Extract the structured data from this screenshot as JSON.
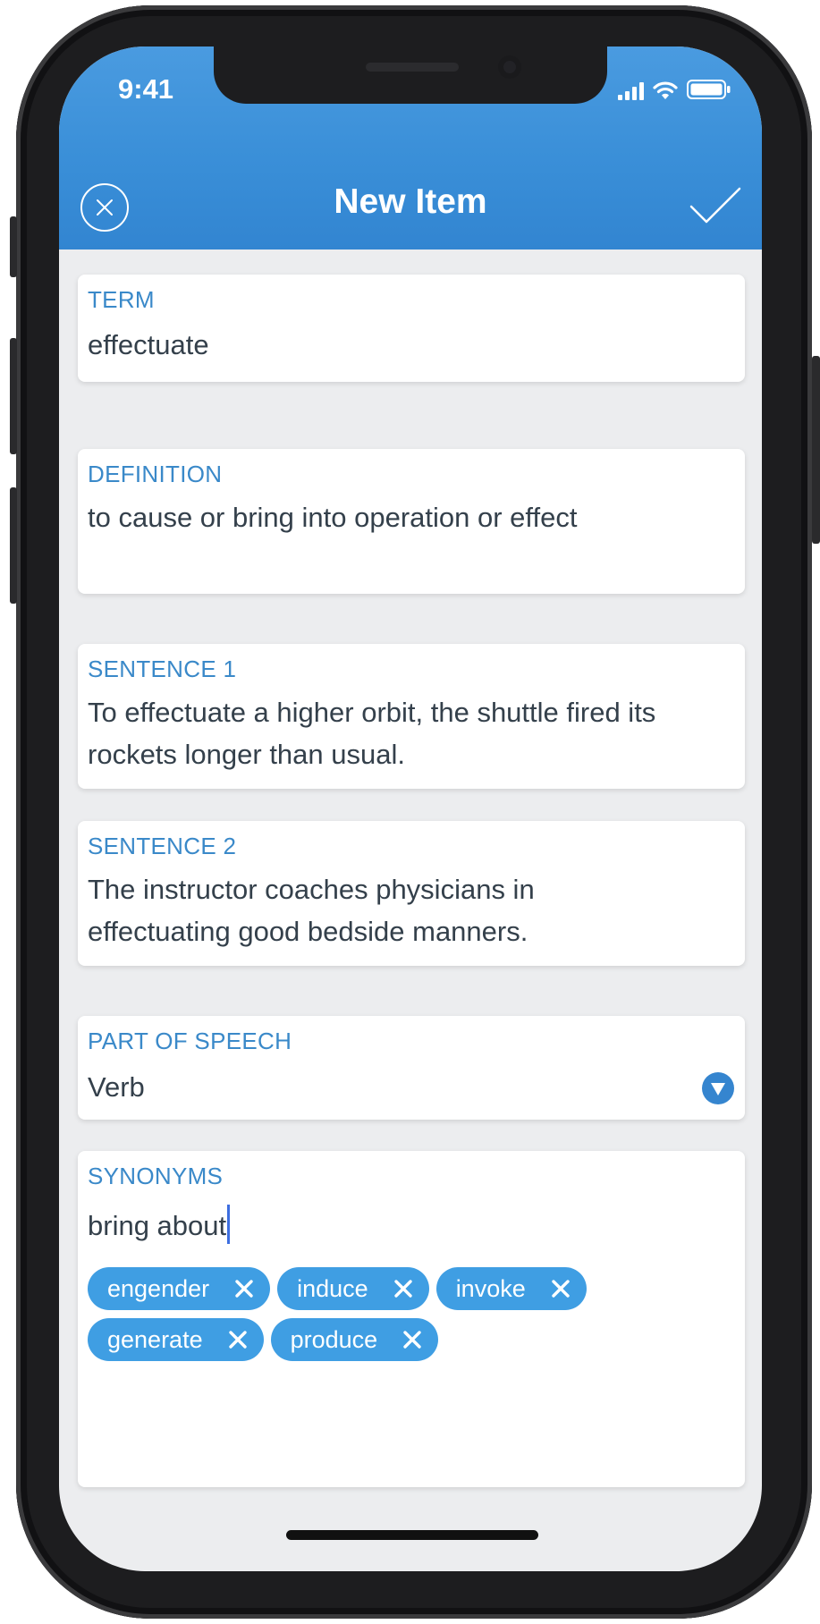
{
  "status_bar": {
    "time": "9:41"
  },
  "header": {
    "title": "New Item",
    "close_icon": "close-circle-icon",
    "confirm_icon": "checkmark-icon",
    "color": "#3a8fd8"
  },
  "fields": {
    "term": {
      "label": "TERM",
      "value": "effectuate"
    },
    "definition": {
      "label": "DEFINITION",
      "value": "to cause or bring into operation or effect"
    },
    "sentence1": {
      "label": "SENTENCE 1",
      "line1": "To effectuate a higher orbit, the shuttle fired its",
      "line2": "rockets longer than usual."
    },
    "sentence2": {
      "label": "SENTENCE 2",
      "line1": "The instructor coaches physicians in",
      "line2": "effectuating good bedside manners."
    },
    "part_of_speech": {
      "label": "PART OF SPEECH",
      "value": "Verb",
      "icon": "dropdown-arrow-icon"
    },
    "synonyms": {
      "label": "SYNONYMS",
      "input_value": "bring about",
      "chips": [
        "engender",
        "induce",
        "invoke",
        "generate",
        "produce"
      ],
      "chip_color": "#3f9ee3"
    }
  }
}
